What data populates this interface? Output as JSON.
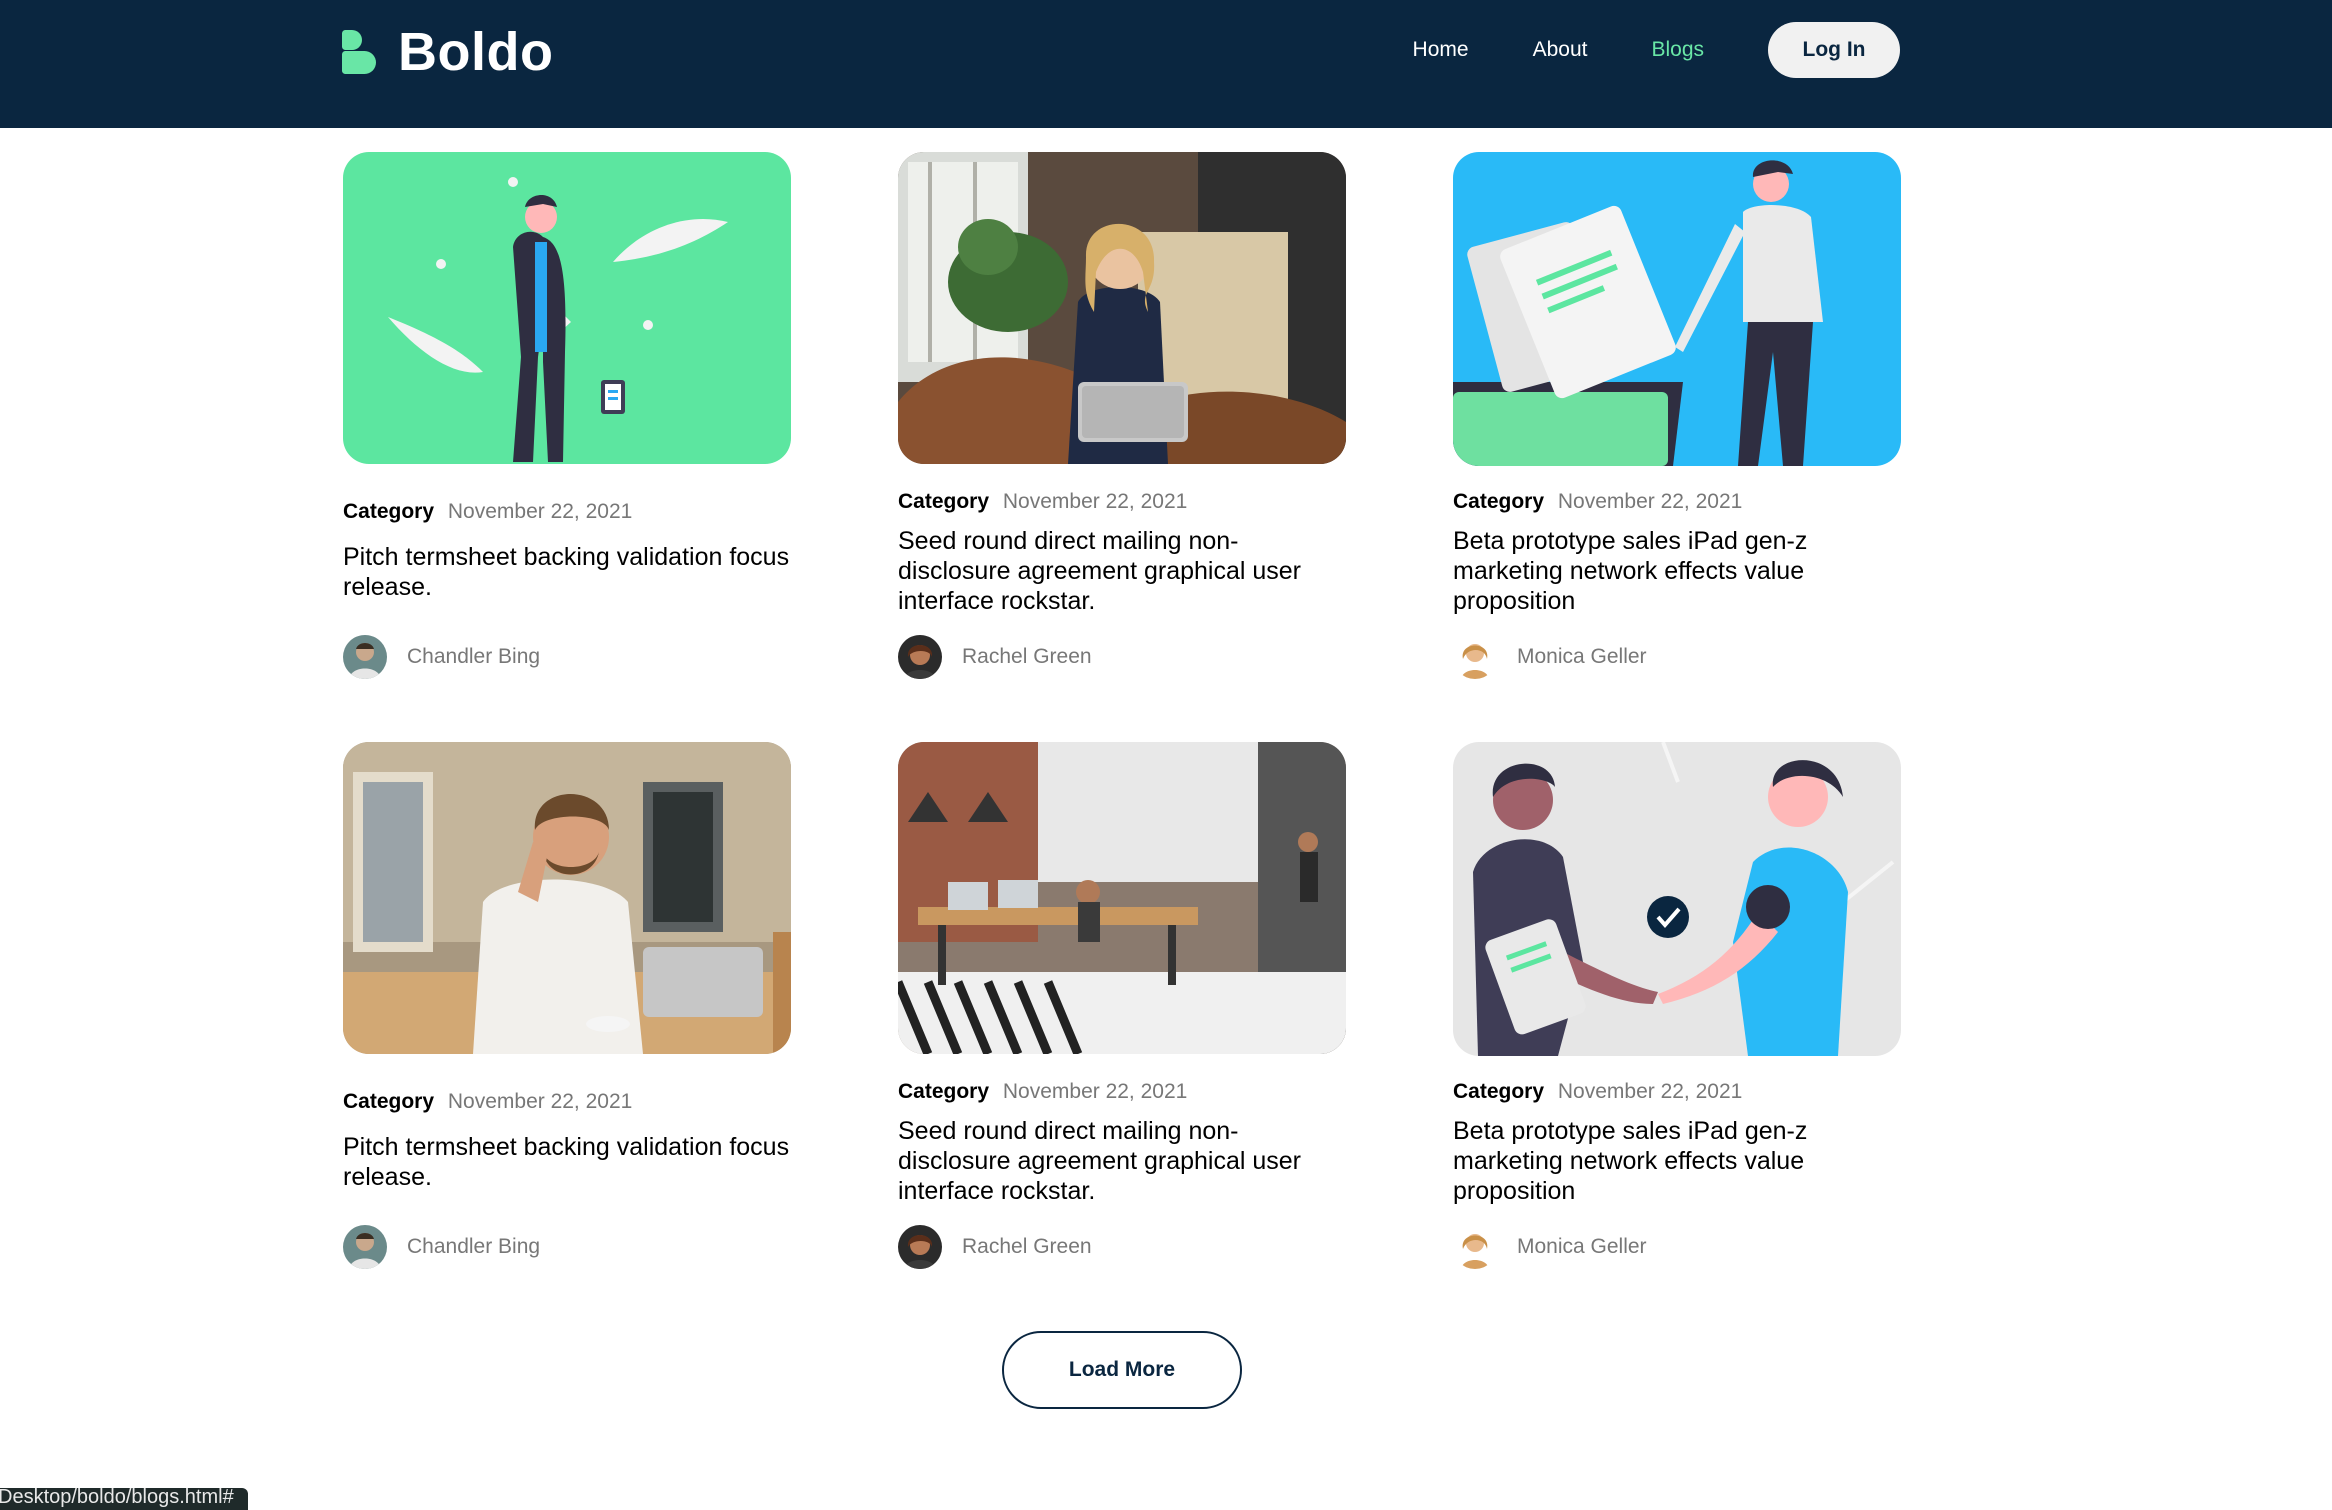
{
  "header": {
    "logo_text": "Boldo",
    "nav": [
      {
        "label": "Home",
        "active": false
      },
      {
        "label": "About",
        "active": false
      },
      {
        "label": "Blogs",
        "active": true
      }
    ],
    "login_label": "Log In",
    "colors": {
      "background": "#0a2640",
      "accent": "#69e6a6"
    }
  },
  "posts": [
    {
      "category": "Category",
      "date": "November 22, 2021",
      "title": "Pitch termsheet backing validation focus release.",
      "author": "Chandler Bing",
      "image": "illustration-man-green-bg"
    },
    {
      "category": "Category",
      "date": "November 22, 2021",
      "title": "Seed round direct mailing non-disclosure agreement graphical user interface rockstar.",
      "author": "Rachel Green",
      "image": "photo-woman-on-phone-with-laptop"
    },
    {
      "category": "Category",
      "date": "November 22, 2021",
      "title": "Beta prototype sales iPad gen-z marketing network effects value proposition",
      "author": "Monica Geller",
      "image": "illustration-man-with-documents-blue-bg"
    },
    {
      "category": "Category",
      "date": "November 22, 2021",
      "title": "Pitch termsheet backing validation focus release.",
      "author": "Chandler Bing",
      "image": "photo-man-on-phone-at-desk"
    },
    {
      "category": "Category",
      "date": "November 22, 2021",
      "title": "Seed round direct mailing non-disclosure agreement graphical user interface rockstar.",
      "author": "Rachel Green",
      "image": "photo-open-office"
    },
    {
      "category": "Category",
      "date": "November 22, 2021",
      "title": "Beta prototype sales iPad gen-z marketing network effects value proposition",
      "author": "Monica Geller",
      "image": "illustration-handshake"
    }
  ],
  "load_more_label": "Load More",
  "status_bar_url": "Desktop/boldo/blogs.html#"
}
